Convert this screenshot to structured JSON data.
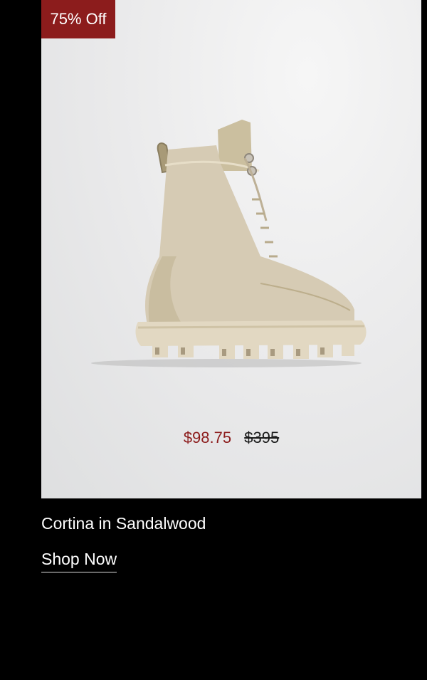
{
  "badge": {
    "label": "75% Off"
  },
  "product": {
    "name": "Cortina in Sandalwood",
    "sale_price": "$98.75",
    "original_price": "$395",
    "image_alt": "boot-icon"
  },
  "cta": {
    "label": "Shop Now"
  },
  "colors": {
    "sale": "#8c1c1c",
    "boot": "#d6cbb4",
    "background": "#000000"
  }
}
